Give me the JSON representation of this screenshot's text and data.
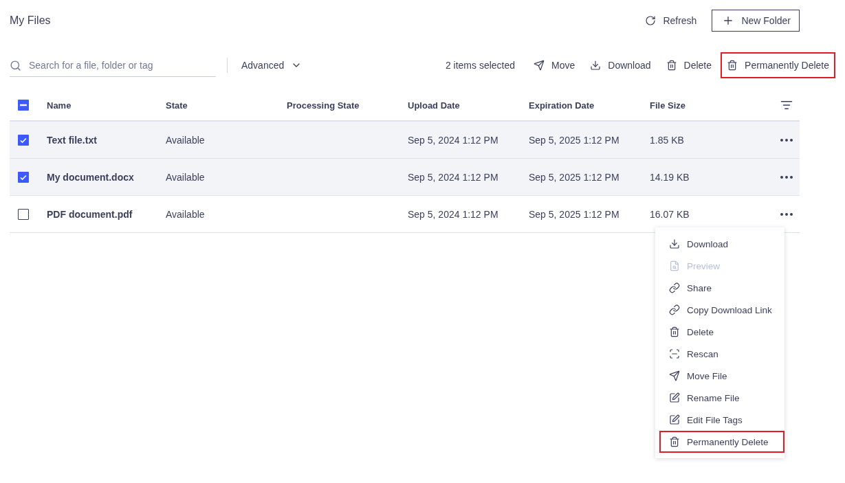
{
  "page_title": "My Files",
  "header_actions": [
    {
      "kind": "refresh",
      "label": "Refresh"
    },
    {
      "kind": "new-folder",
      "label": "New Folder"
    }
  ],
  "search": {
    "placeholder": "Search for a file, folder or tag"
  },
  "advanced": {
    "label": "Advanced",
    "expanded": false
  },
  "selection_count": "2 items selected",
  "bulk_actions": [
    {
      "kind": "move",
      "label": "Move",
      "highlighted": false
    },
    {
      "kind": "download",
      "label": "Download",
      "highlighted": false
    },
    {
      "kind": "trash",
      "label": "Delete",
      "highlighted": false
    },
    {
      "kind": "trash",
      "label": "Permanently Delete",
      "highlighted": true
    }
  ],
  "table": {
    "select_all_indeterminate": true,
    "columns": [
      "Name",
      "State",
      "Processing State",
      "Upload Date",
      "Expiration Date",
      "File Size"
    ],
    "rows": [
      {
        "checked": true,
        "name": "Text file.txt",
        "state": "Available",
        "upload_date": "Sep 5, 2024 1:12 PM",
        "expiration_date": "Sep 5, 2025 1:12 PM",
        "file_size": "1.85 KB"
      },
      {
        "checked": true,
        "name": "My document.docx",
        "state": "Available",
        "upload_date": "Sep 5, 2024 1:12 PM",
        "expiration_date": "Sep 5, 2025 1:12 PM",
        "file_size": "14.19 KB"
      },
      {
        "checked": false,
        "name": "PDF document.pdf",
        "state": "Available",
        "upload_date": "Sep 5, 2024 1:12 PM",
        "expiration_date": "Sep 5, 2025 1:12 PM",
        "file_size": "16.07 KB"
      }
    ]
  },
  "context_menu": {
    "items": [
      {
        "kind": "download",
        "label": "Download",
        "disabled": false,
        "highlighted": false
      },
      {
        "kind": "preview",
        "label": "Preview",
        "disabled": true,
        "highlighted": false
      },
      {
        "kind": "link",
        "label": "Share",
        "disabled": false,
        "highlighted": false
      },
      {
        "kind": "link",
        "label": "Copy Download Link",
        "disabled": false,
        "highlighted": false
      },
      {
        "kind": "trash",
        "label": "Delete",
        "disabled": false,
        "highlighted": false
      },
      {
        "kind": "scan",
        "label": "Rescan",
        "disabled": false,
        "highlighted": false
      },
      {
        "kind": "move",
        "label": "Move File",
        "disabled": false,
        "highlighted": false
      },
      {
        "kind": "edit",
        "label": "Rename File",
        "disabled": false,
        "highlighted": false
      },
      {
        "kind": "edit",
        "label": "Edit File Tags",
        "disabled": false,
        "highlighted": false
      },
      {
        "kind": "trash",
        "label": "Permanently Delete",
        "disabled": false,
        "highlighted": true
      }
    ]
  }
}
